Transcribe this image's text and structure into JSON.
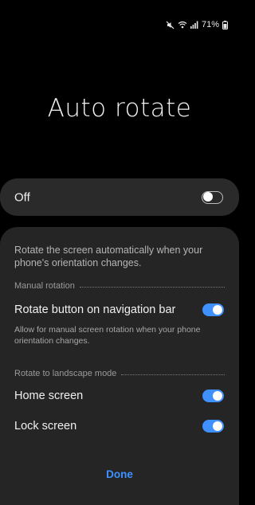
{
  "status_bar": {
    "battery_text": "71%"
  },
  "page": {
    "title": "Auto rotate"
  },
  "master": {
    "label": "Off",
    "toggle_on": false
  },
  "options": {
    "description": "Rotate the screen automatically when your phone's orientation changes.",
    "manual_rotation": {
      "header": "Manual rotation",
      "rotate_button_label": "Rotate button on navigation bar",
      "rotate_button_on": true,
      "rotate_button_desc": "Allow for manual screen rotation when your phone orientation changes."
    },
    "landscape": {
      "header": "Rotate to landscape mode",
      "home_screen_label": "Home screen",
      "home_screen_on": true,
      "lock_screen_label": "Lock screen",
      "lock_screen_on": true
    }
  },
  "footer": {
    "done_label": "Done"
  },
  "colors": {
    "accent": "#3e91ff",
    "card_background": "#2a2a2a",
    "screen_background": "#000000"
  }
}
